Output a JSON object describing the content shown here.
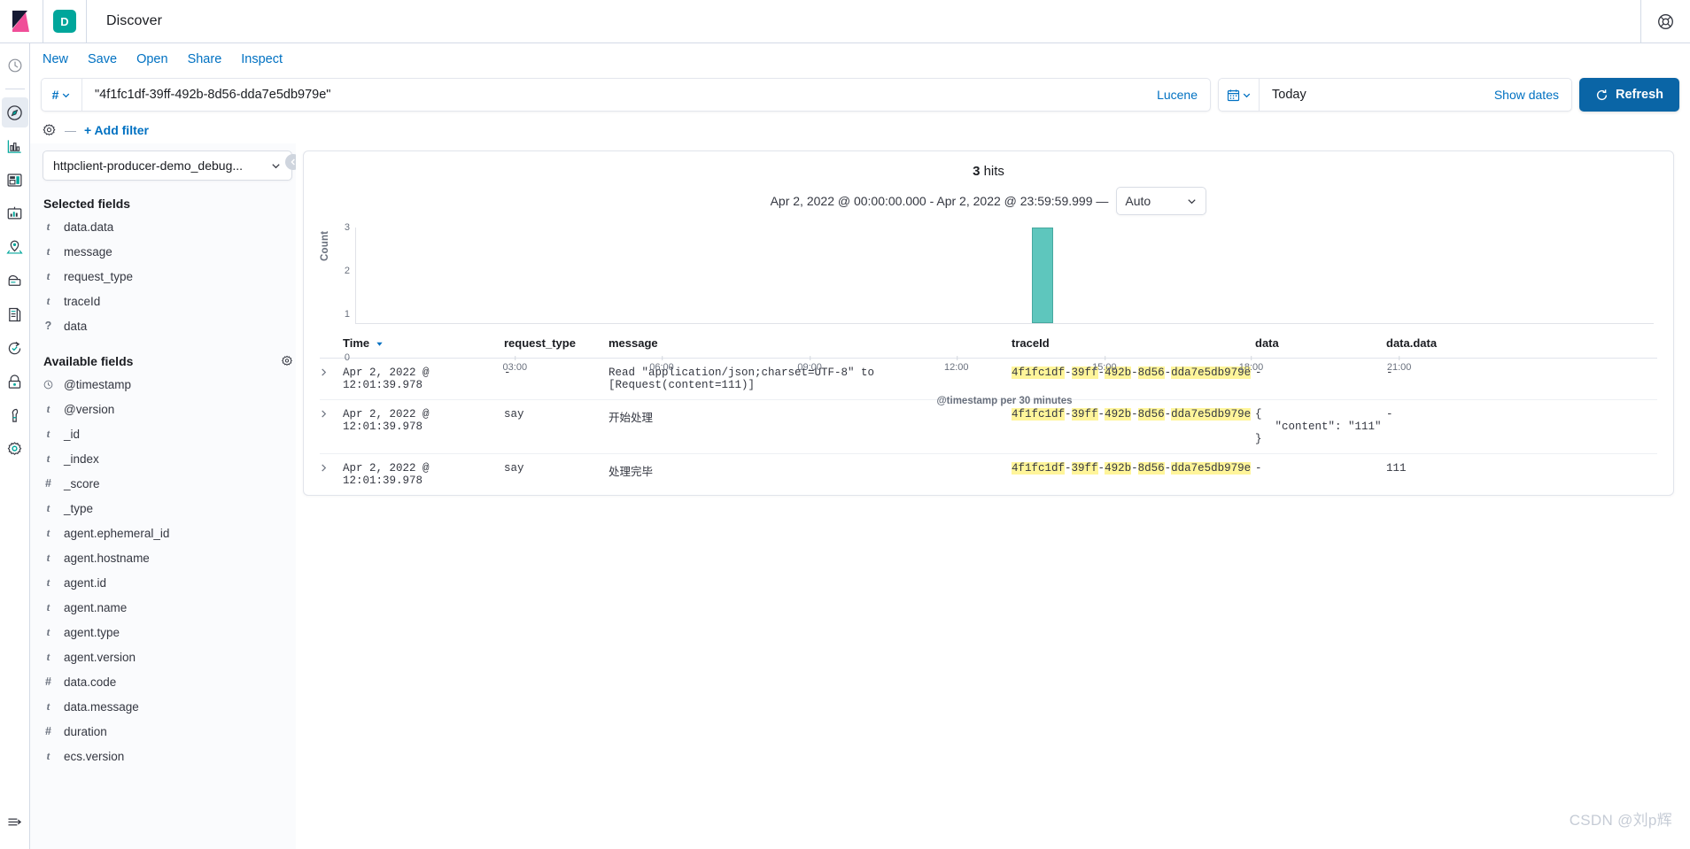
{
  "header": {
    "app_badge": "D",
    "title": "Discover",
    "help_icon": "help-circle-icon"
  },
  "nav": {
    "links": [
      "New",
      "Save",
      "Open",
      "Share",
      "Inspect"
    ]
  },
  "query": {
    "prefix_icon": "hash-icon",
    "value": "\"4f1fc1df-39ff-492b-8d56-dda7e5db979e\"",
    "language": "Lucene",
    "date_icon": "calendar-icon",
    "date_value": "Today",
    "show_dates": "Show dates",
    "refresh_label": "Refresh",
    "refresh_icon": "refresh-icon",
    "accent": "#0a65a6"
  },
  "filters": {
    "settings_icon": "gear-icon",
    "separator": "—",
    "add_filter": "+ Add filter"
  },
  "sidebar": {
    "index_pattern": "httpclient-producer-demo_debug...",
    "selected_heading": "Selected fields",
    "selected_fields": [
      {
        "type": "t",
        "name": "data.data"
      },
      {
        "type": "t",
        "name": "message"
      },
      {
        "type": "t",
        "name": "request_type"
      },
      {
        "type": "t",
        "name": "traceId"
      },
      {
        "type": "?",
        "name": "data"
      }
    ],
    "available_heading": "Available fields",
    "available_settings_icon": "gear-icon",
    "available_fields": [
      {
        "type": "clock",
        "name": "@timestamp"
      },
      {
        "type": "t",
        "name": "@version"
      },
      {
        "type": "t",
        "name": "_id"
      },
      {
        "type": "t",
        "name": "_index"
      },
      {
        "type": "#",
        "name": "_score"
      },
      {
        "type": "t",
        "name": "_type"
      },
      {
        "type": "t",
        "name": "agent.ephemeral_id"
      },
      {
        "type": "t",
        "name": "agent.hostname"
      },
      {
        "type": "t",
        "name": "agent.id"
      },
      {
        "type": "t",
        "name": "agent.name"
      },
      {
        "type": "t",
        "name": "agent.type"
      },
      {
        "type": "t",
        "name": "agent.version"
      },
      {
        "type": "#",
        "name": "data.code"
      },
      {
        "type": "t",
        "name": "data.message"
      },
      {
        "type": "#",
        "name": "duration"
      },
      {
        "type": "t",
        "name": "ecs.version"
      }
    ]
  },
  "rail": {
    "items": [
      "recently-viewed-clock-icon",
      "discover-compass-icon",
      "visualize-chart-icon",
      "dashboard-icon",
      "canvas-icon",
      "maps-icon",
      "machine-learning-icon",
      "logs-icon",
      "uptime-icon",
      "security-lock-icon",
      "dev-tools-wrench-icon",
      "management-gear-icon"
    ],
    "collapse_icon": "collapse-nav-icon"
  },
  "results": {
    "hits_count": "3",
    "hits_label": "hits",
    "time_range": "Apr 2, 2022 @ 00:00:00.000 - Apr 2, 2022 @ 23:59:59.999 —",
    "interval": "Auto"
  },
  "chart_data": {
    "type": "bar",
    "title": "",
    "xlabel": "@timestamp per 30 minutes",
    "ylabel": "Count",
    "ylim": [
      0,
      3
    ],
    "yticks": [
      0,
      1,
      2,
      3
    ],
    "xticks": [
      "03:00",
      "06:00",
      "09:00",
      "12:00",
      "15:00",
      "18:00",
      "21:00"
    ],
    "bar_color": "#5ec6bd",
    "categories": [
      "12:00"
    ],
    "values": [
      3
    ],
    "grid": false,
    "legend": "none"
  },
  "table": {
    "columns": [
      "Time",
      "request_type",
      "message",
      "traceId",
      "data",
      "data.data"
    ],
    "sort_icon": "sort-desc-icon",
    "expand_icon": "chevron-right-icon",
    "rows": [
      {
        "time": "Apr 2, 2022 @ 12:01:39.978",
        "request_type": "-",
        "message": "Read \"application/json;charset=UTF-8\" to [Request(content=111)]",
        "traceId": "4f1fc1df-39ff-492b-8d56-dda7e5db979e",
        "data": "-",
        "data_data": "-"
      },
      {
        "time": "Apr 2, 2022 @ 12:01:39.978",
        "request_type": "say",
        "message": "开始处理",
        "traceId": "4f1fc1df-39ff-492b-8d56-dda7e5db979e",
        "data": "{\n   \"content\": \"111\"\n}",
        "data_data": "-"
      },
      {
        "time": "Apr 2, 2022 @ 12:01:39.978",
        "request_type": "say",
        "message": "处理完毕",
        "traceId": "4f1fc1df-39ff-492b-8d56-dda7e5db979e",
        "data": "-",
        "data_data": "111"
      }
    ]
  },
  "watermark": "CSDN @刘p辉"
}
